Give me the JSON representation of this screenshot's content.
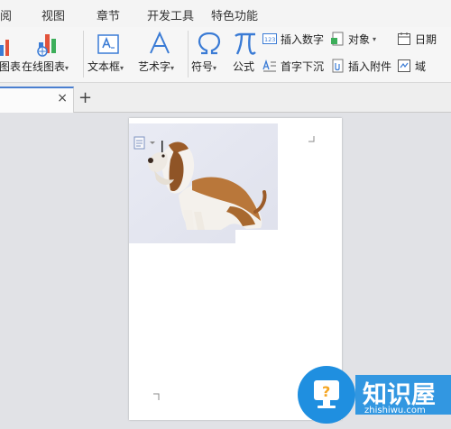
{
  "menu": {
    "items": [
      {
        "label": "阅"
      },
      {
        "label": "视图"
      },
      {
        "label": "章节"
      },
      {
        "label": "开发工具"
      },
      {
        "label": "特色功能"
      }
    ]
  },
  "ribbon": {
    "chart_label": "图表",
    "online_chart_label": "在线图表",
    "textbox_label": "文本框",
    "wordart_label": "艺术字",
    "symbol_label": "符号",
    "formula_label": "公式",
    "insert_number_label": "插入数字",
    "object_label": "对象",
    "date_label": "日期",
    "dropcap_label": "首字下沉",
    "attachment_label": "插入附件",
    "field_label": "域",
    "caret": "▾"
  },
  "tabs": {
    "close": "×",
    "new_tab": "+"
  },
  "watermark": {
    "title": "知识屋",
    "url": "zhishiwu.com"
  },
  "colors": {
    "accent": "#4a7fd0",
    "watermark_blue": "#1f8fe0"
  }
}
